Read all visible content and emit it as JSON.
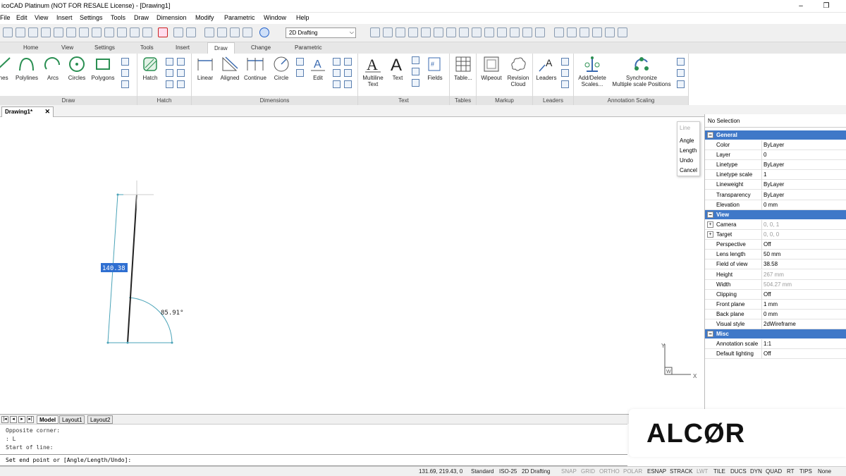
{
  "window": {
    "title": "icoCAD Platinum (NOT FOR RESALE License) - [Drawing1]",
    "minimize": "–",
    "restore": "❐"
  },
  "menu": [
    "File",
    "Edit",
    "View",
    "Insert",
    "Settings",
    "Tools",
    "Draw",
    "Dimension",
    "Modify",
    "Parametric",
    "Window",
    "Help"
  ],
  "toolbar": {
    "workspace_value": "2D Drafting",
    "workspace_arrow": "⌵"
  },
  "ribbon_tabs": [
    "Home",
    "View",
    "Settings",
    "Tools",
    "Insert",
    "Draw",
    "Change",
    "Parametric"
  ],
  "ribbon_active_tab": "Draw",
  "ribbon": {
    "draw": {
      "title": "Draw",
      "buttons": [
        "Lines",
        "Polylines",
        "Arcs",
        "Circles",
        "Polygons"
      ]
    },
    "hatch": {
      "title": "Hatch",
      "button": "Hatch"
    },
    "dimensions": {
      "title": "Dimensions",
      "buttons": [
        "Linear",
        "Aligned",
        "Continue",
        "Circle",
        "Edit"
      ]
    },
    "text": {
      "title": "Text",
      "multiline_1": "Multiline",
      "multiline_2": "Text",
      "text": "Text",
      "fields": "Fields"
    },
    "tables": {
      "title": "Tables",
      "button": "Table..."
    },
    "markup": {
      "title": "Markup",
      "wipeout": "Wipeout",
      "revision_1": "Revision",
      "revision_2": "Cloud"
    },
    "leaders": {
      "title": "Leaders",
      "button": "Leaders"
    },
    "annotation_scaling": {
      "title": "Annotation Scaling",
      "add_1": "Add/Delete",
      "add_2": "Scales...",
      "sync_1": "Synchronize",
      "sync_2": "Multiple scale Positions"
    }
  },
  "doc_tab": {
    "label": "Drawing1*",
    "close": "✕"
  },
  "canvas": {
    "dimension_value": "140.38",
    "angle_label": "85.91°",
    "ucs_y": "Y",
    "ucs_x": "X",
    "ucs_w": "W"
  },
  "context_menu": [
    "Line",
    "Angle",
    "Length",
    "Undo",
    "Cancel"
  ],
  "properties": {
    "selection": "No Selection",
    "sections": {
      "general": "General",
      "view": "View",
      "misc": "Misc"
    },
    "general": [
      {
        "k": "Color",
        "v": "ByLayer"
      },
      {
        "k": "Layer",
        "v": "0"
      },
      {
        "k": "Linetype",
        "v": "ByLayer"
      },
      {
        "k": "Linetype scale",
        "v": "1"
      },
      {
        "k": "Lineweight",
        "v": "ByLayer"
      },
      {
        "k": "Transparency",
        "v": "ByLayer"
      },
      {
        "k": "Elevation",
        "v": "0 mm"
      }
    ],
    "view": [
      {
        "k": "Camera",
        "v": "0, 0, 1"
      },
      {
        "k": "Target",
        "v": "0, 0, 0"
      },
      {
        "k": "Perspective",
        "v": "Off"
      },
      {
        "k": "Lens length",
        "v": "50 mm"
      },
      {
        "k": "Field of view",
        "v": "38.58"
      },
      {
        "k": "Height",
        "v": "267 mm"
      },
      {
        "k": "Width",
        "v": "504.27 mm"
      },
      {
        "k": "Clipping",
        "v": "Off"
      },
      {
        "k": "Front plane",
        "v": "1 mm"
      },
      {
        "k": "Back plane",
        "v": "0 mm"
      },
      {
        "k": "Visual style",
        "v": "2dWireframe"
      }
    ],
    "misc": [
      {
        "k": "Annotation scale",
        "v": "1:1"
      },
      {
        "k": "Default lighting",
        "v": "Off"
      }
    ],
    "expand": "+",
    "collapse": "−"
  },
  "layout_tabs": {
    "nav": [
      "|◂",
      "◂",
      "▸",
      "▸|"
    ],
    "tabs": [
      "Model",
      "Layout1",
      "Layout2"
    ]
  },
  "command": {
    "history": [
      "Opposite corner:",
      ": L",
      "Start of line:"
    ],
    "prompt": "Set end point or [Angle/Length/Undo]:"
  },
  "brand": "ALCØR",
  "status": {
    "coords": "131.69, 219.43, 0",
    "items": [
      "Standard",
      "ISO-25",
      "2D Drafting",
      "SNAP",
      "GRID",
      "ORTHO",
      "POLAR",
      "ESNAP",
      "STRACK",
      "LWT",
      "TILE",
      "DUCS",
      "DYN",
      "QUAD",
      "RT",
      "TIPS",
      "None"
    ]
  },
  "colors": {
    "accent": "#3f78c8",
    "dimension": "#4aa3b8",
    "selection": "#2f6fd1"
  }
}
